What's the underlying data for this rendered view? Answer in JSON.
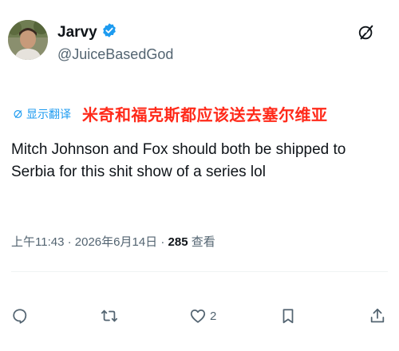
{
  "author": {
    "display_name": "Jarvy",
    "handle": "@JuiceBasedGod",
    "verified": true
  },
  "translate": {
    "link_label": "显示翻译",
    "translated_text": "米奇和福克斯都应该送去塞尔维亚"
  },
  "tweet": {
    "text": "Mitch Johnson and Fox should both be shipped to Serbia for this shit show of a series lol"
  },
  "meta": {
    "time": "上午11:43",
    "separator1": " · ",
    "date": "2026年6月14日",
    "separator2": " · ",
    "views_count": "285",
    "views_label": " 查看"
  },
  "actions": {
    "reply_count": "",
    "repost_count": "",
    "like_count": "2",
    "bookmark_count": ""
  },
  "colors": {
    "accent": "#1d9bf0",
    "translation_red": "#ff2a1a",
    "secondary_text": "#536471",
    "primary_text": "#0f1419"
  },
  "icons": {
    "verified": "verified-badge-icon",
    "grok": "grok-icon",
    "translate": "translate-icon",
    "reply": "reply-icon",
    "repost": "repost-icon",
    "like": "like-icon",
    "bookmark": "bookmark-icon",
    "share": "share-icon"
  }
}
